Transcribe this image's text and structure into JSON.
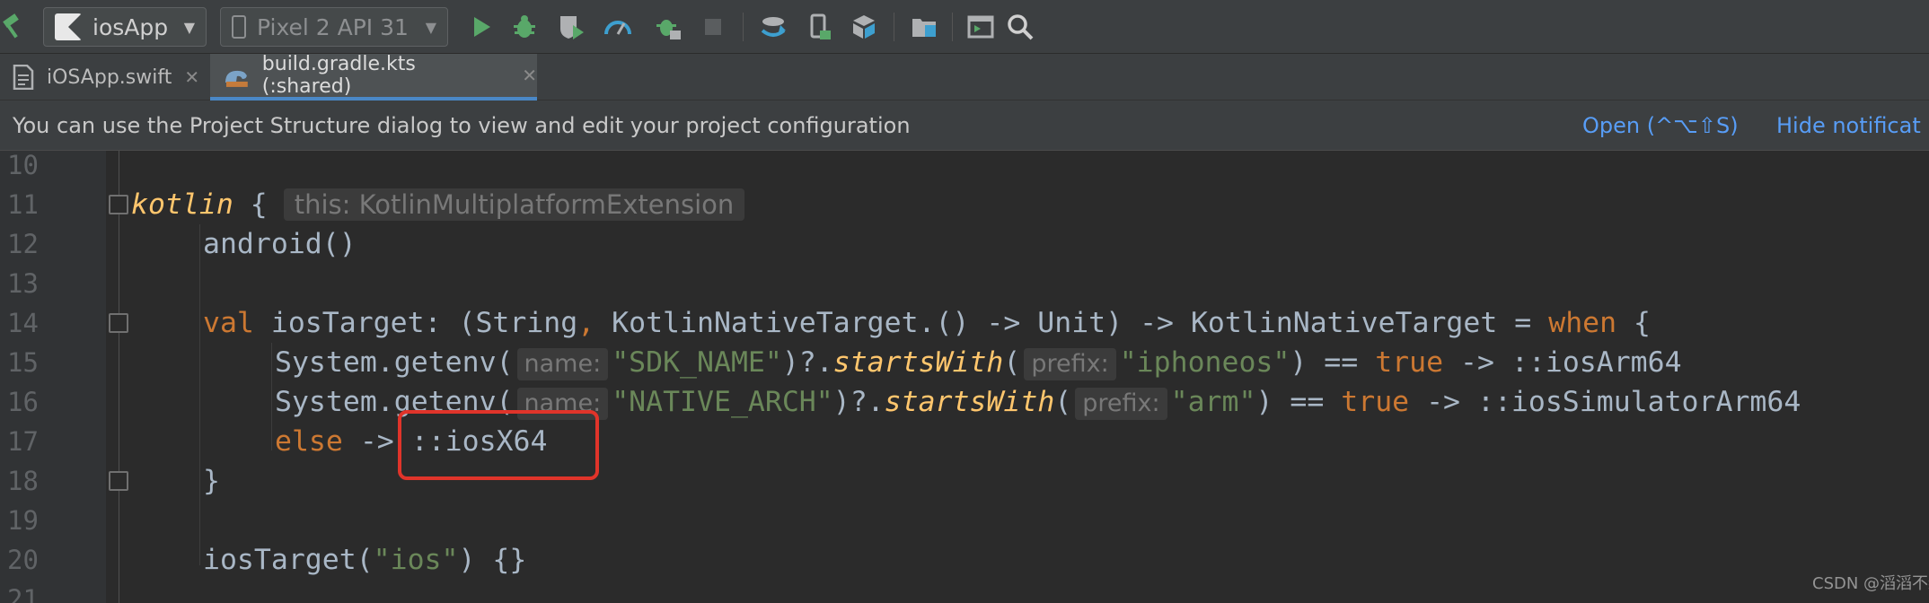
{
  "toolbar": {
    "app_config": "iosApp",
    "device": "Pixel 2 API 31",
    "icons": [
      "hammer-icon",
      "run-icon",
      "debug-icon",
      "coverage-icon",
      "profile-icon",
      "attach-debugger-icon",
      "stop-icon",
      "sync-icon",
      "device-manager-icon",
      "sdk-manager-icon",
      "project-structure-icon",
      "terminal-icon",
      "search-icon"
    ]
  },
  "tabs": [
    {
      "label": "iOSApp.swift",
      "active": false
    },
    {
      "label": "build.gradle.kts (:shared)",
      "active": true
    }
  ],
  "notification": {
    "message": "You can use the Project Structure dialog to view and edit your project configuration",
    "open_link": "Open (^⌥⇧S)",
    "hide_link": "Hide notificat"
  },
  "editor": {
    "line_numbers": [
      "10",
      "11",
      "12",
      "13",
      "14",
      "15",
      "16",
      "17",
      "18",
      "19",
      "20",
      "21"
    ],
    "line11": {
      "kw": "kotlin",
      "brace": " {",
      "hint": "this: KotlinMultiplatformExtension"
    },
    "line12": {
      "text": "android()"
    },
    "line14": {
      "val": "val",
      "mid": " iosTarget: (String",
      "comma": ",",
      "rest": " KotlinNativeTarget.() -> Unit) -> KotlinNativeTarget = ",
      "when": "when",
      "brace": " {"
    },
    "line15": {
      "pre": "System.getenv(",
      "hint1": "name:",
      "str1": "\"SDK_NAME\"",
      "mid": ")?.",
      "fn": "startsWith",
      "paren": "(",
      "hint2": "prefix:",
      "str2": "\"iphoneos\"",
      "eq": ") == ",
      "true": "true",
      "arrow": " -> ::iosArm64"
    },
    "line16": {
      "pre": "System.getenv(",
      "hint1": "name:",
      "str1": "\"NATIVE_ARCH\"",
      "mid": ")?.",
      "fn": "startsWith",
      "paren": "(",
      "hint2": "prefix:",
      "str2": "\"arm\"",
      "eq": ") == ",
      "true": "true",
      "arrow": " -> ::iosSimulatorArm64"
    },
    "line17": {
      "else": "else",
      "arrow": " -> ",
      "target": "::iosX64"
    },
    "line18": {
      "text": "}"
    },
    "line20": {
      "pre": "iosTarget(",
      "str": "\"ios\"",
      "post": ") {}"
    }
  },
  "watermark": "CSDN @滔滔不绝"
}
